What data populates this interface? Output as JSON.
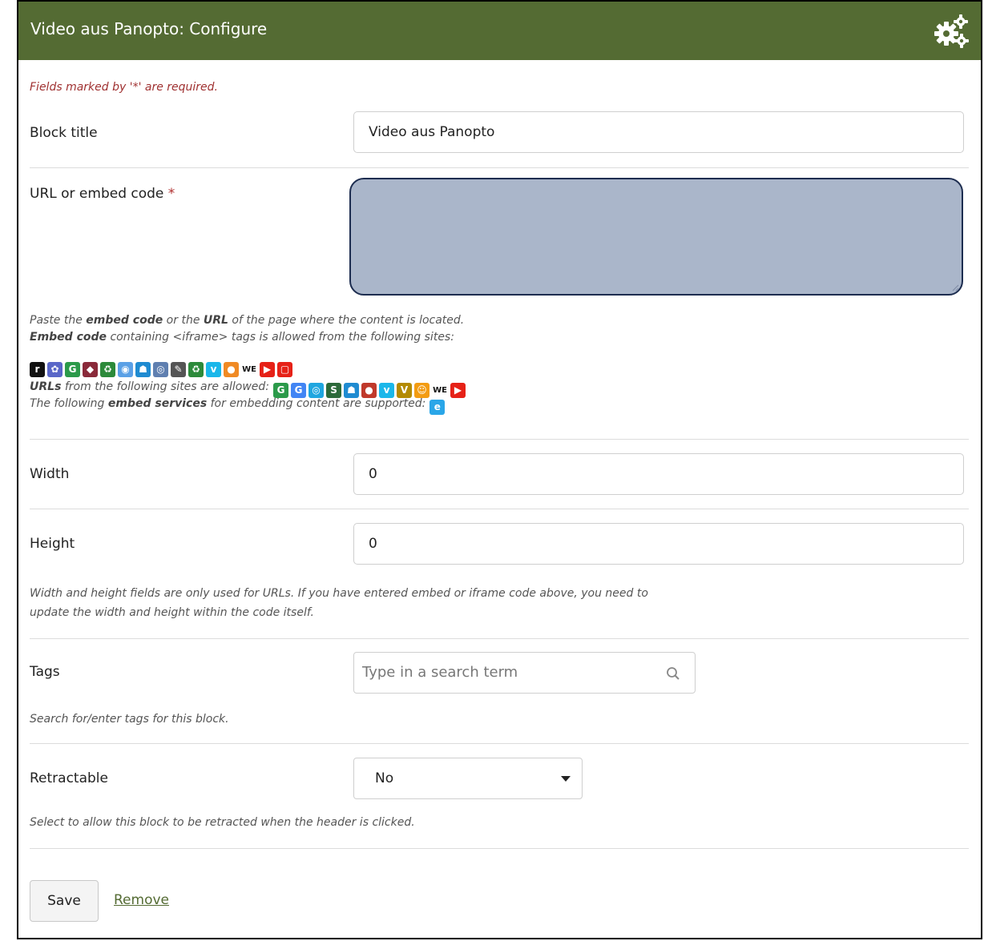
{
  "header": {
    "title": "Video aus Panopto: Configure",
    "icon": "gears-icon",
    "background": "#546b33"
  },
  "form": {
    "required_note": "Fields marked by '*' are required.",
    "block_title": {
      "label": "Block title",
      "value": "Video aus Panopto"
    },
    "url_embed": {
      "label": "URL or embed code",
      "required_mark": "*",
      "value": "",
      "help_line1_pre": "Paste the ",
      "help_line1_b1": "embed code",
      "help_line1_mid": " or the ",
      "help_line1_b2": "URL",
      "help_line1_post": " of the page where the content is located.",
      "help_line2_b": "Embed code",
      "help_line2_post": " containing <iframe> tags is allowed from the following sites:",
      "help_line3_b": "URLs",
      "help_line3_post": " from the following sites are allowed:",
      "help_line4_pre": "The following ",
      "help_line4_b": "embed services",
      "help_line4_post": " for embedding content are supported:",
      "iframe_site_icons": [
        {
          "name": "mahara-r-icon",
          "glyph": "r",
          "color": "#111111"
        },
        {
          "name": "flower-icon",
          "glyph": "✿",
          "color": "#5a67c8"
        },
        {
          "name": "glogster-icon",
          "glyph": "G",
          "color": "#2b9a4a"
        },
        {
          "name": "prezi-icon",
          "glyph": "◆",
          "color": "#8a2a3a"
        },
        {
          "name": "recycle-icon",
          "glyph": "♻",
          "color": "#2c8a3a"
        },
        {
          "name": "sphere-icon",
          "glyph": "◉",
          "color": "#5aa0e6"
        },
        {
          "name": "slideshare-icon",
          "glyph": "☗",
          "color": "#1f8bd1"
        },
        {
          "name": "globe-icon",
          "glyph": "◎",
          "color": "#5f7fb0"
        },
        {
          "name": "scribble-icon",
          "glyph": "✎",
          "color": "#555555"
        },
        {
          "name": "recycle-icon-2",
          "glyph": "♻",
          "color": "#2c8a3a"
        },
        {
          "name": "vimeo-icon",
          "glyph": "v",
          "color": "#1ab7ea"
        },
        {
          "name": "chat-bubble-icon",
          "glyph": "●",
          "color": "#f08a24"
        },
        {
          "name": "wikieducator-icon",
          "glyph": "WE",
          "color": "transparent"
        },
        {
          "name": "youtube-icon",
          "glyph": "▶",
          "color": "#e62117"
        },
        {
          "name": "youtube-outline-icon",
          "glyph": "▢",
          "color": "#e62117"
        }
      ],
      "url_site_icons": [
        {
          "name": "glogster-icon",
          "glyph": "G",
          "color": "#2b9a4a"
        },
        {
          "name": "google-icon",
          "glyph": "G",
          "color": "#4285f4"
        },
        {
          "name": "target-icon",
          "glyph": "◎",
          "color": "#1fa6e0"
        },
        {
          "name": "scratch-icon",
          "glyph": "S",
          "color": "#2c6a3a"
        },
        {
          "name": "slideshare-icon",
          "glyph": "☗",
          "color": "#1f8bd1"
        },
        {
          "name": "apple-icon",
          "glyph": "●",
          "color": "#c0392b"
        },
        {
          "name": "vimeo-icon",
          "glyph": "v",
          "color": "#1ab7ea"
        },
        {
          "name": "voki-icon",
          "glyph": "V",
          "color": "#b38a00"
        },
        {
          "name": "person-icon",
          "glyph": "☺",
          "color": "#f39c12"
        },
        {
          "name": "wikieducator-icon",
          "glyph": "WE",
          "color": "transparent"
        },
        {
          "name": "youtube-icon",
          "glyph": "▶",
          "color": "#e62117"
        }
      ],
      "embed_service_icons": [
        {
          "name": "embedly-icon",
          "glyph": "e",
          "color": "#2aa6e8"
        }
      ]
    },
    "width": {
      "label": "Width",
      "value": "0"
    },
    "height": {
      "label": "Height",
      "value": "0"
    },
    "size_help_line1": "Width and height fields are only used for URLs. If you have entered embed or iframe code above, you need to",
    "size_help_line2": "update the width and height within the code itself.",
    "tags": {
      "label": "Tags",
      "placeholder": "Type in a search term",
      "help": "Search for/enter tags for this block."
    },
    "retractable": {
      "label": "Retractable",
      "value": "No",
      "help": "Select to allow this block to be retracted when the header is clicked."
    },
    "save_label": "Save",
    "remove_label": "Remove"
  }
}
